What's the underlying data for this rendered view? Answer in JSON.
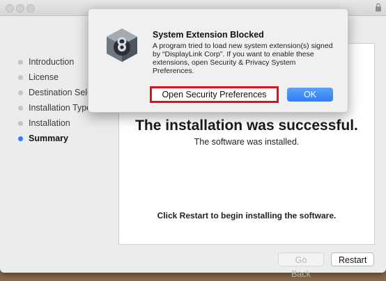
{
  "installer": {
    "sidebar": {
      "items": [
        {
          "label": "Introduction"
        },
        {
          "label": "License"
        },
        {
          "label": "Destination Sele"
        },
        {
          "label": "Installation Type"
        },
        {
          "label": "Installation"
        },
        {
          "label": "Summary"
        }
      ]
    },
    "content": {
      "headline": "The installation was successful.",
      "subline": "The software was installed.",
      "restart_note": "Click Restart to begin installing the software."
    },
    "buttons": {
      "back": "Go Back",
      "restart": "Restart"
    }
  },
  "alert": {
    "title": "System Extension Blocked",
    "body": "A program tried to load new system extension(s) signed by “DisplayLink Corp”. If you want to enable these extensions, open Security & Privacy System Preferences.",
    "secondary_button": "Open Security Preferences",
    "primary_button": "OK",
    "icon": "security-preferences-icon"
  },
  "colors": {
    "accent": "#2f7df6",
    "highlight_box": "#e0111b"
  }
}
